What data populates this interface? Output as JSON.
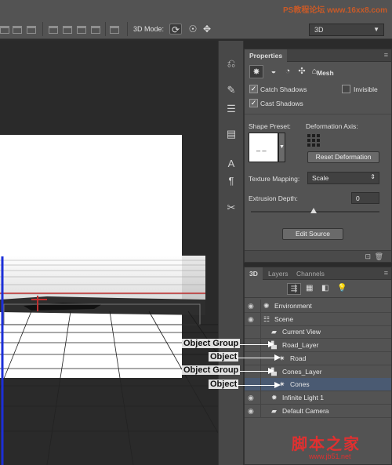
{
  "watermark_top": "PS教程论坛 www.16xx8.com",
  "options_bar": {
    "mode_label": "3D Mode:",
    "select_value": "3D"
  },
  "properties": {
    "tab": "Properties",
    "mesh_label": "Mesh",
    "catch_shadows": "Catch Shadows",
    "invisible": "Invisible",
    "cast_shadows": "Cast Shadows",
    "shape_preset": "Shape Preset:",
    "deformation_axis": "Deformation Axis:",
    "reset_deformation": "Reset Deformation",
    "texture_mapping": "Texture Mapping:",
    "texture_value": "Scale",
    "extrusion_depth": "Extrusion Depth:",
    "extrusion_value": "0",
    "edit_source": "Edit Source"
  },
  "layers_panel": {
    "tabs": [
      "3D",
      "Layers",
      "Channels"
    ],
    "rows": [
      {
        "label": "Environment",
        "indent": 0,
        "icon": "environment-icon",
        "eye": true
      },
      {
        "label": "Scene",
        "indent": 0,
        "icon": "scene-icon",
        "eye": true
      },
      {
        "label": "Current View",
        "indent": 1,
        "icon": "camera-icon",
        "eye": false
      },
      {
        "label": "Road_Layer",
        "indent": 1,
        "icon": "group-icon",
        "eye": false
      },
      {
        "label": "Road",
        "indent": 2,
        "icon": "mesh-icon",
        "eye": false
      },
      {
        "label": "Cones_Layer",
        "indent": 1,
        "icon": "group-icon",
        "eye": false
      },
      {
        "label": "Cones",
        "indent": 2,
        "icon": "mesh-icon",
        "eye": false,
        "selected": true
      },
      {
        "label": "Infinite Light 1",
        "indent": 1,
        "icon": "light-icon",
        "eye": true
      },
      {
        "label": "Default Camera",
        "indent": 1,
        "icon": "camera-icon",
        "eye": true
      }
    ]
  },
  "callouts": [
    "Object Group",
    "Object",
    "Object Group",
    "Object"
  ],
  "watermark_bottom": "脚本之家",
  "watermark_url": "www.jb51.net",
  "colors": {
    "panel_bg": "#535353",
    "dark_bg": "#2b2b2b",
    "selected_row": "#4a5a72",
    "watermark": "#e03030"
  }
}
